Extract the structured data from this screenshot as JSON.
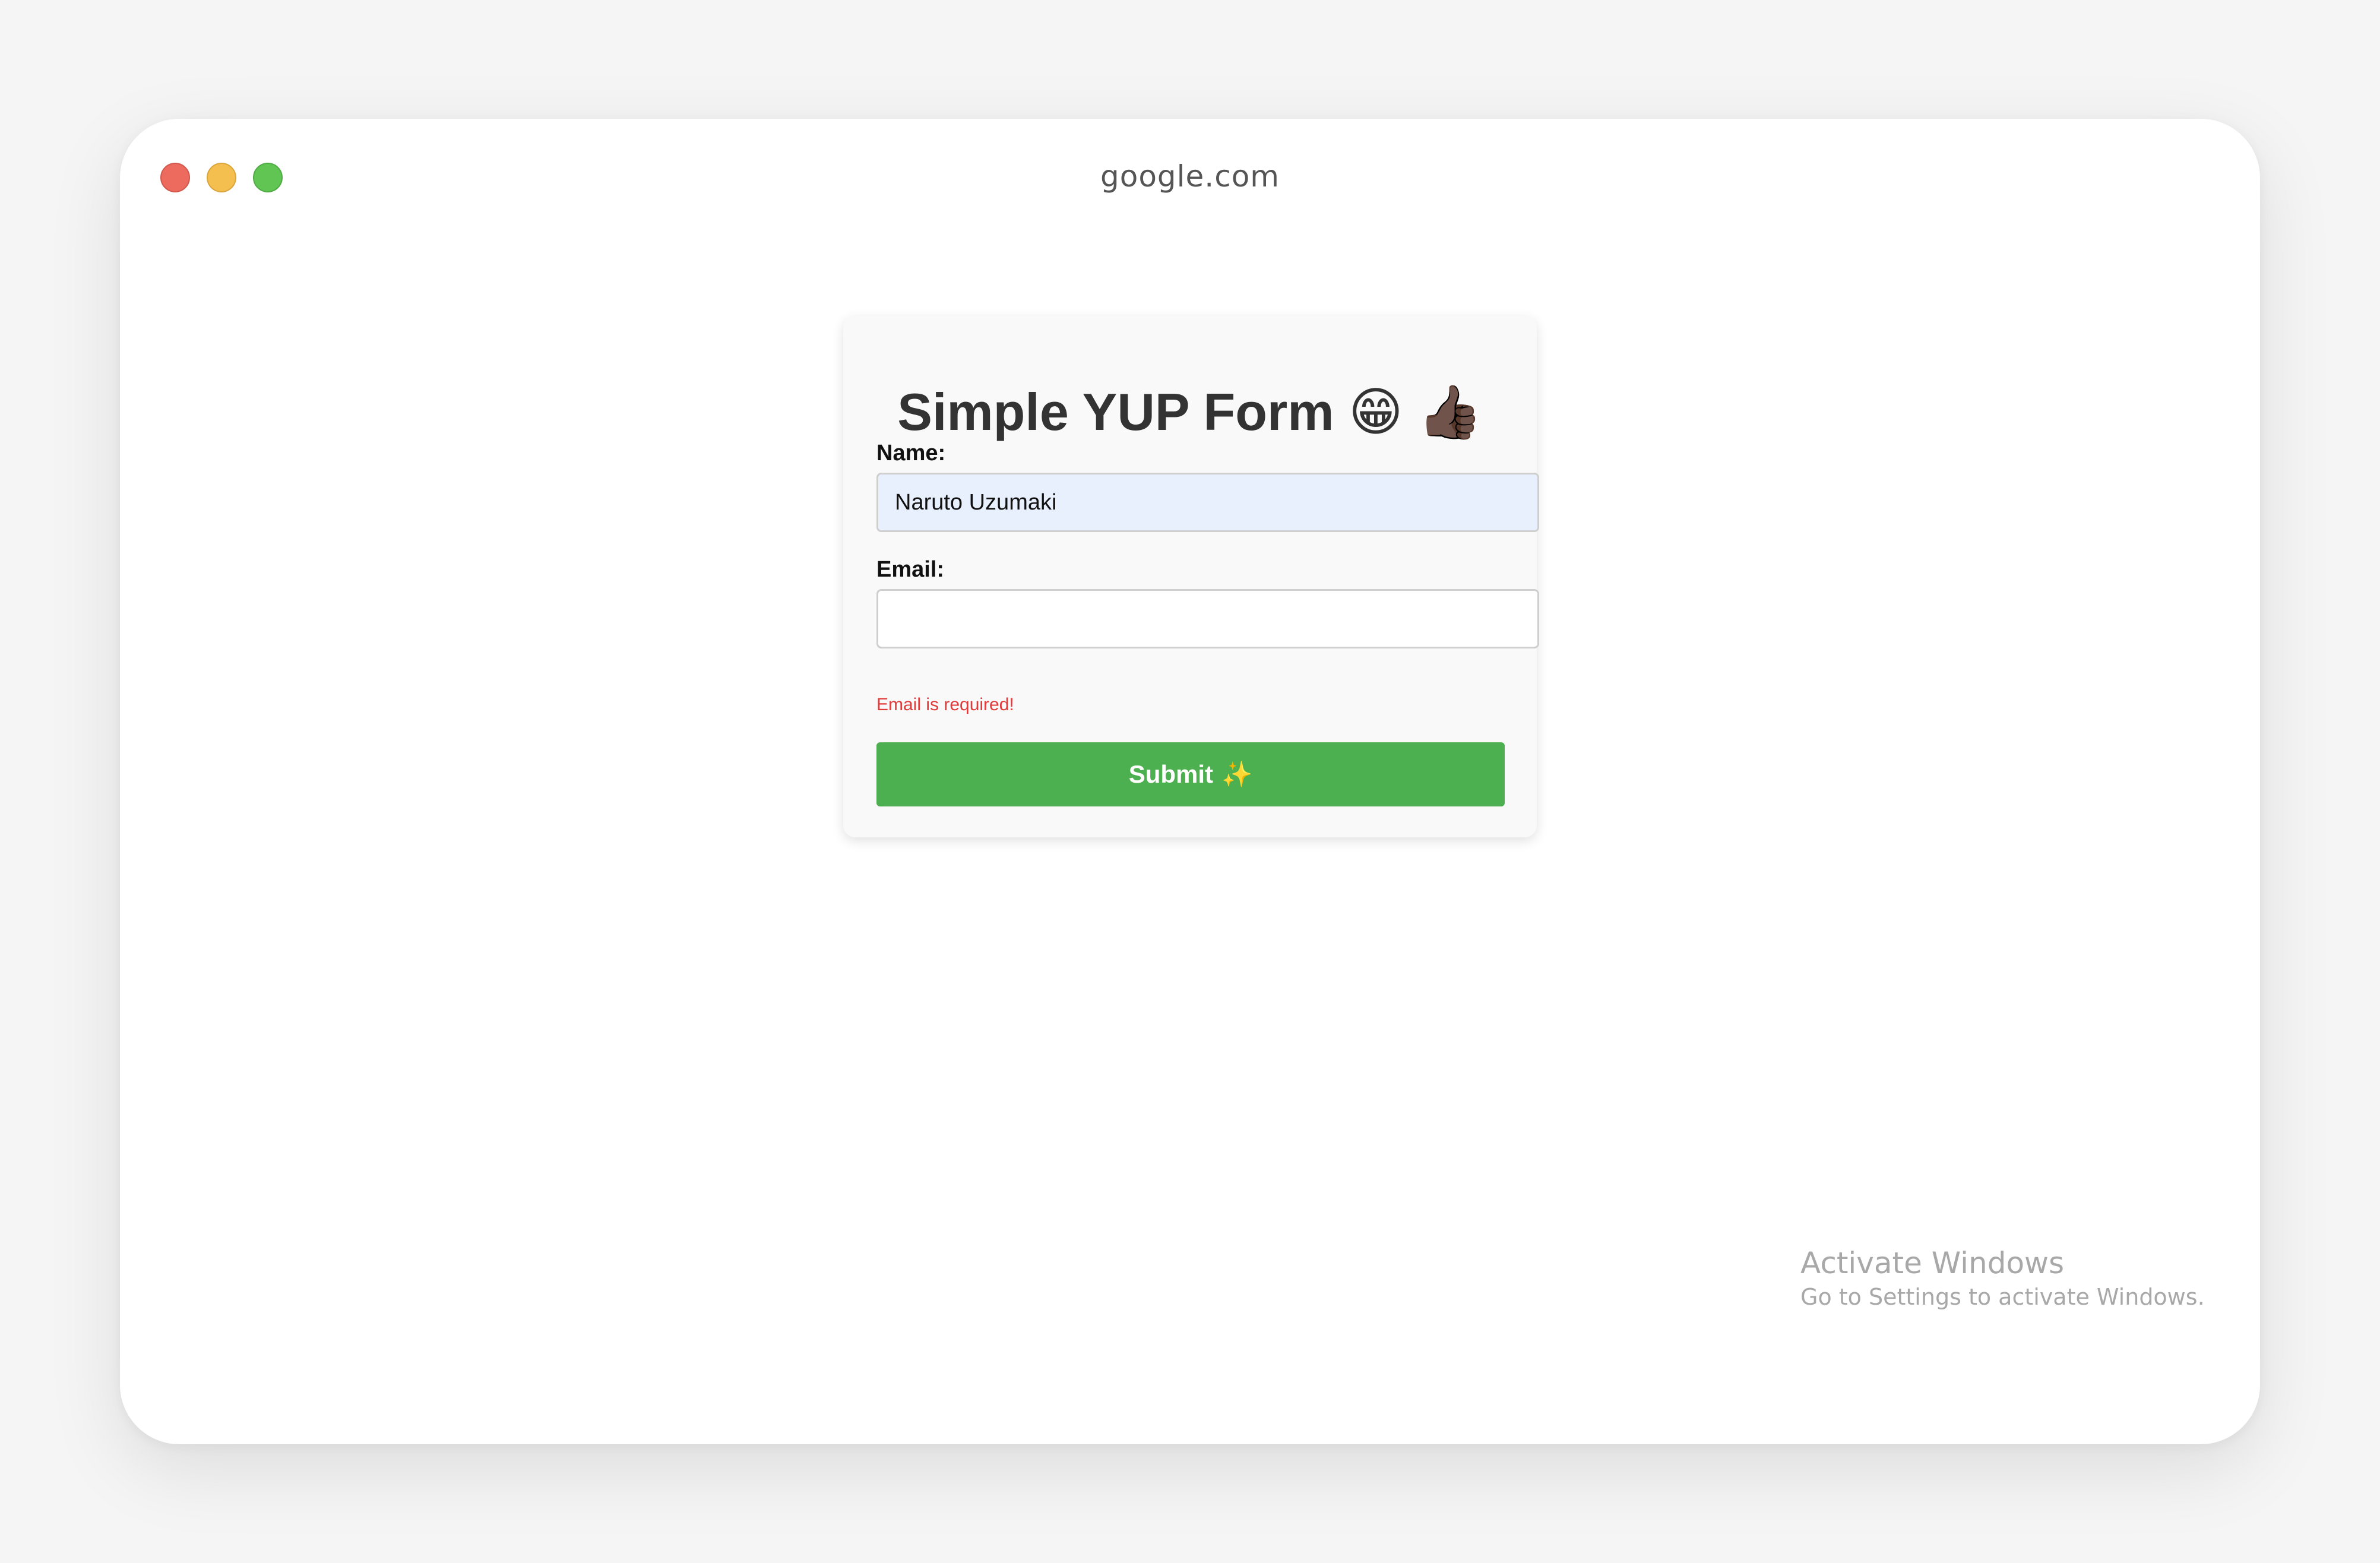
{
  "browser": {
    "url": "google.com"
  },
  "form": {
    "title": "Simple YUP Form",
    "title_emoji_1": "😁",
    "title_emoji_2": "👍🏿",
    "name_label": "Name:",
    "name_value": "Naruto Uzumaki",
    "email_label": "Email:",
    "email_value": "",
    "email_error": "Email is required!",
    "submit_label": "Submit",
    "submit_emoji": "✨"
  },
  "watermark": {
    "title": "Activate Windows",
    "subtitle": "Go to Settings to activate Windows."
  },
  "colors": {
    "submit": "#4caf50",
    "error": "#e03b3b",
    "filled_input": "#e8f0fe"
  }
}
